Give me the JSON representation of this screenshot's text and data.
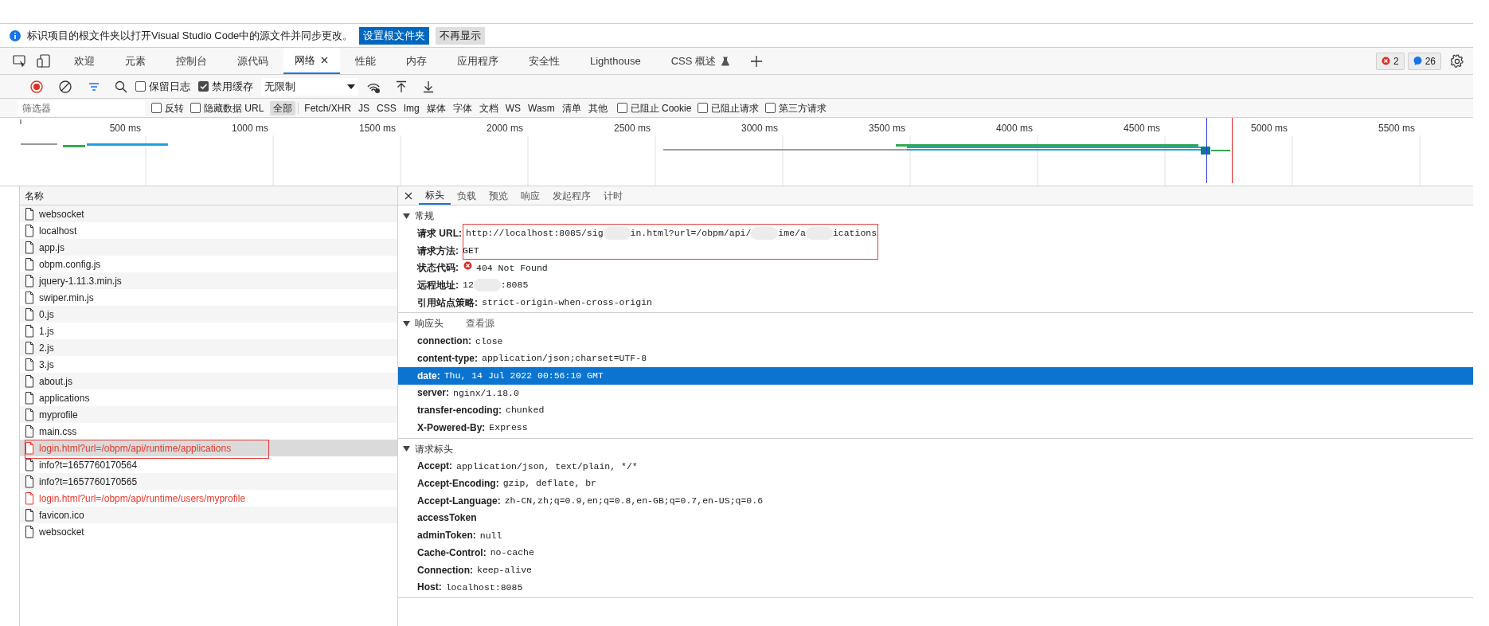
{
  "infobar": {
    "message": "标识项目的根文件夹以打开Visual Studio Code中的源文件并同步更改。",
    "buttons": [
      {
        "label": "设置根文件夹",
        "kind": "primary"
      },
      {
        "label": "不再显示",
        "kind": "secondary"
      }
    ]
  },
  "tabs": [
    {
      "label": "欢迎",
      "selected": false,
      "closable": false,
      "experimental": false
    },
    {
      "label": "元素",
      "selected": false,
      "closable": false,
      "experimental": false
    },
    {
      "label": "控制台",
      "selected": false,
      "closable": false,
      "experimental": false
    },
    {
      "label": "源代码",
      "selected": false,
      "closable": false,
      "experimental": false
    },
    {
      "label": "网络",
      "selected": true,
      "closable": true,
      "experimental": false
    },
    {
      "label": "性能",
      "selected": false,
      "closable": false,
      "experimental": false
    },
    {
      "label": "内存",
      "selected": false,
      "closable": false,
      "experimental": false
    },
    {
      "label": "应用程序",
      "selected": false,
      "closable": false,
      "experimental": false
    },
    {
      "label": "安全性",
      "selected": false,
      "closable": false,
      "experimental": false
    },
    {
      "label": "Lighthouse",
      "selected": false,
      "closable": false,
      "experimental": false
    },
    {
      "label": "CSS 概述",
      "selected": false,
      "closable": false,
      "experimental": true
    }
  ],
  "badges": [
    {
      "kind": "error",
      "count": "2"
    },
    {
      "kind": "message",
      "count": "26"
    }
  ],
  "toolbar": {
    "checkboxes": [
      {
        "label": "保留日志",
        "checked": false
      },
      {
        "label": "禁用缓存",
        "checked": true
      }
    ],
    "throttle": "无限制"
  },
  "filter": {
    "placeholder": "筛选器",
    "checkboxes_left": [
      {
        "label": "反转",
        "checked": false
      },
      {
        "label": "隐藏数据 URL",
        "checked": false
      }
    ],
    "types": [
      {
        "label": "全部",
        "selected": true
      },
      {
        "label": "Fetch/XHR",
        "selected": false
      },
      {
        "label": "JS",
        "selected": false
      },
      {
        "label": "CSS",
        "selected": false
      },
      {
        "label": "Img",
        "selected": false
      },
      {
        "label": "媒体",
        "selected": false
      },
      {
        "label": "字体",
        "selected": false
      },
      {
        "label": "文档",
        "selected": false
      },
      {
        "label": "WS",
        "selected": false
      },
      {
        "label": "Wasm",
        "selected": false
      },
      {
        "label": "清单",
        "selected": false
      },
      {
        "label": "其他",
        "selected": false
      }
    ],
    "checkboxes_right": [
      {
        "label": "已阻止 Cookie",
        "checked": false
      },
      {
        "label": "已阻止请求",
        "checked": false
      },
      {
        "label": "第三方请求",
        "checked": false
      }
    ]
  },
  "timeline": {
    "ticks": [
      "500 ms",
      "1000 ms",
      "1500 ms",
      "2000 ms",
      "2500 ms",
      "3000 ms",
      "3500 ms",
      "4000 ms",
      "4500 ms",
      "5000 ms",
      "5500 ms"
    ]
  },
  "requests": {
    "column": "名称",
    "rows": [
      {
        "name": "websocket",
        "selected": false,
        "failed": false
      },
      {
        "name": "localhost",
        "selected": false,
        "failed": false
      },
      {
        "name": "app.js",
        "selected": false,
        "failed": false
      },
      {
        "name": "obpm.config.js",
        "selected": false,
        "failed": false
      },
      {
        "name": "jquery-1.11.3.min.js",
        "selected": false,
        "failed": false
      },
      {
        "name": "swiper.min.js",
        "selected": false,
        "failed": false
      },
      {
        "name": "0.js",
        "selected": false,
        "failed": false
      },
      {
        "name": "1.js",
        "selected": false,
        "failed": false
      },
      {
        "name": "2.js",
        "selected": false,
        "failed": false
      },
      {
        "name": "3.js",
        "selected": false,
        "failed": false
      },
      {
        "name": "about.js",
        "selected": false,
        "failed": false
      },
      {
        "name": "applications",
        "selected": false,
        "failed": false
      },
      {
        "name": "myprofile",
        "selected": false,
        "failed": false
      },
      {
        "name": "main.css",
        "selected": false,
        "failed": false
      },
      {
        "name": "login.html?url=/obpm/api/runtime/applications",
        "selected": true,
        "failed": true
      },
      {
        "name": "info?t=1657760170564",
        "selected": false,
        "failed": false
      },
      {
        "name": "info?t=1657760170565",
        "selected": false,
        "failed": false
      },
      {
        "name": "login.html?url=/obpm/api/runtime/users/myprofile",
        "selected": false,
        "failed": true
      },
      {
        "name": "favicon.ico",
        "selected": false,
        "failed": false
      },
      {
        "name": "websocket",
        "selected": false,
        "failed": false
      }
    ]
  },
  "details": {
    "tabs": [
      {
        "label": "标头",
        "selected": true
      },
      {
        "label": "负载",
        "selected": false
      },
      {
        "label": "预览",
        "selected": false
      },
      {
        "label": "响应",
        "selected": false
      },
      {
        "label": "发起程序",
        "selected": false
      },
      {
        "label": "计时",
        "selected": false
      }
    ],
    "sections": [
      {
        "title": "常规",
        "expanded": true,
        "rows": [
          {
            "kind": "redacted",
            "key": "请求 URL:",
            "value_parts": [
              "http://localhost:8085/sig",
              "in.html?url=/obpm/api/",
              "ime/a",
              "ications"
            ],
            "selected": false
          },
          {
            "kind": "text",
            "key": "请求方法:",
            "value": "GET",
            "selected": false
          },
          {
            "kind": "status",
            "key": "状态代码:",
            "value": "404 Not Found",
            "selected": false
          },
          {
            "kind": "redacted",
            "key": "远程地址:",
            "value_parts": [
              "12",
              ":8085"
            ],
            "selected": false
          },
          {
            "kind": "text",
            "key": "引用站点策略:",
            "value": "strict-origin-when-cross-origin",
            "selected": false
          }
        ]
      },
      {
        "title": "响应头",
        "action": "查看源",
        "expanded": true,
        "rows": [
          {
            "kind": "text",
            "key": "connection:",
            "value": "close",
            "selected": false
          },
          {
            "kind": "text",
            "key": "content-type:",
            "value": "application/json;charset=UTF-8",
            "selected": false
          },
          {
            "kind": "text",
            "key": "date:",
            "value": "Thu, 14 Jul 2022 00:56:10 GMT",
            "selected": true
          },
          {
            "kind": "text",
            "key": "server:",
            "value": "nginx/1.18.0",
            "selected": false
          },
          {
            "kind": "text",
            "key": "transfer-encoding:",
            "value": "chunked",
            "selected": false
          },
          {
            "kind": "text",
            "key": "X-Powered-By:",
            "value": "Express",
            "selected": false
          }
        ]
      },
      {
        "title": "请求标头",
        "expanded": true,
        "rows": [
          {
            "kind": "text",
            "key": "Accept:",
            "value": "application/json, text/plain, */*",
            "selected": false
          },
          {
            "kind": "text",
            "key": "Accept-Encoding:",
            "value": "gzip, deflate, br",
            "selected": false
          },
          {
            "kind": "text",
            "key": "Accept-Language:",
            "value": "zh-CN,zh;q=0.9,en;q=0.8,en-GB;q=0.7,en-US;q=0.6",
            "selected": false
          },
          {
            "kind": "text",
            "key": "accessToken",
            "selected": false
          },
          {
            "kind": "text",
            "key": "adminToken:",
            "value": "null",
            "selected": false
          },
          {
            "kind": "text",
            "key": "Cache-Control:",
            "value": "no-cache",
            "selected": false
          },
          {
            "kind": "text",
            "key": "Connection:",
            "value": "keep-alive",
            "selected": false
          },
          {
            "kind": "text",
            "key": "Host:",
            "value": "localhost:8085",
            "selected": false
          }
        ]
      }
    ]
  }
}
